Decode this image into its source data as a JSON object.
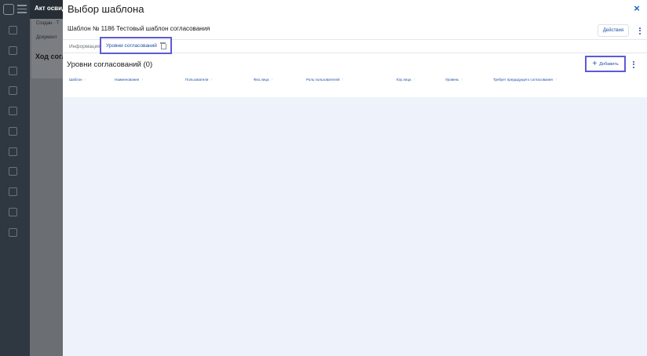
{
  "background": {
    "app_title": "Акт освид",
    "created_label": "Создан · Т",
    "document_label": "Документ",
    "progress_title": "Ход согл"
  },
  "modal": {
    "title": "Выбор шаблона",
    "close_icon": "×",
    "template_name": "Шаблон № 1186 Тестовый шаблон согласования",
    "actions_label": "Действия",
    "tabs": {
      "info": "Информация",
      "levels": "Уровни согласований"
    },
    "section_title": "Уровни согласований (0)",
    "add_label": "Добавить",
    "add_icon": "+",
    "columns": [
      "Шаблон",
      "Наименование",
      "Пользователи",
      "Физ.лица",
      "Роль пользователей",
      "Юр.лица",
      "Уровень",
      "Требует предыдущего согласования"
    ],
    "sort_icon": "↑"
  }
}
